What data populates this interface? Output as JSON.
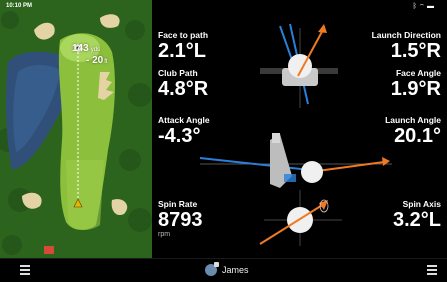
{
  "status": {
    "time": "10:10 PM",
    "icons": [
      "bluetooth-icon",
      "wifi-icon",
      "battery-icon"
    ]
  },
  "map": {
    "distance_value": "143",
    "distance_unit": "yds",
    "elevation_value": "- 20",
    "elevation_unit": "ft"
  },
  "metrics": {
    "face_to_path": {
      "label": "Face to path",
      "value": "2.1°L"
    },
    "club_path": {
      "label": "Club Path",
      "value": "4.8°R"
    },
    "attack_angle": {
      "label": "Attack Angle",
      "value": "-4.3°"
    },
    "spin_rate": {
      "label": "Spin Rate",
      "value": "8793",
      "unit": "rpm"
    },
    "launch_direction": {
      "label": "Launch Direction",
      "value": "1.5°R"
    },
    "face_angle": {
      "label": "Face Angle",
      "value": "1.9°R"
    },
    "launch_angle": {
      "label": "Launch Angle",
      "value": "20.1°"
    },
    "spin_axis": {
      "label": "Spin Axis",
      "value": "3.2°L"
    }
  },
  "colors": {
    "launch_arrow": "#f07a24",
    "club_path_line": "#2a7fd8",
    "fairway": "#8cbf3c"
  },
  "bottombar": {
    "user_name": "James"
  }
}
